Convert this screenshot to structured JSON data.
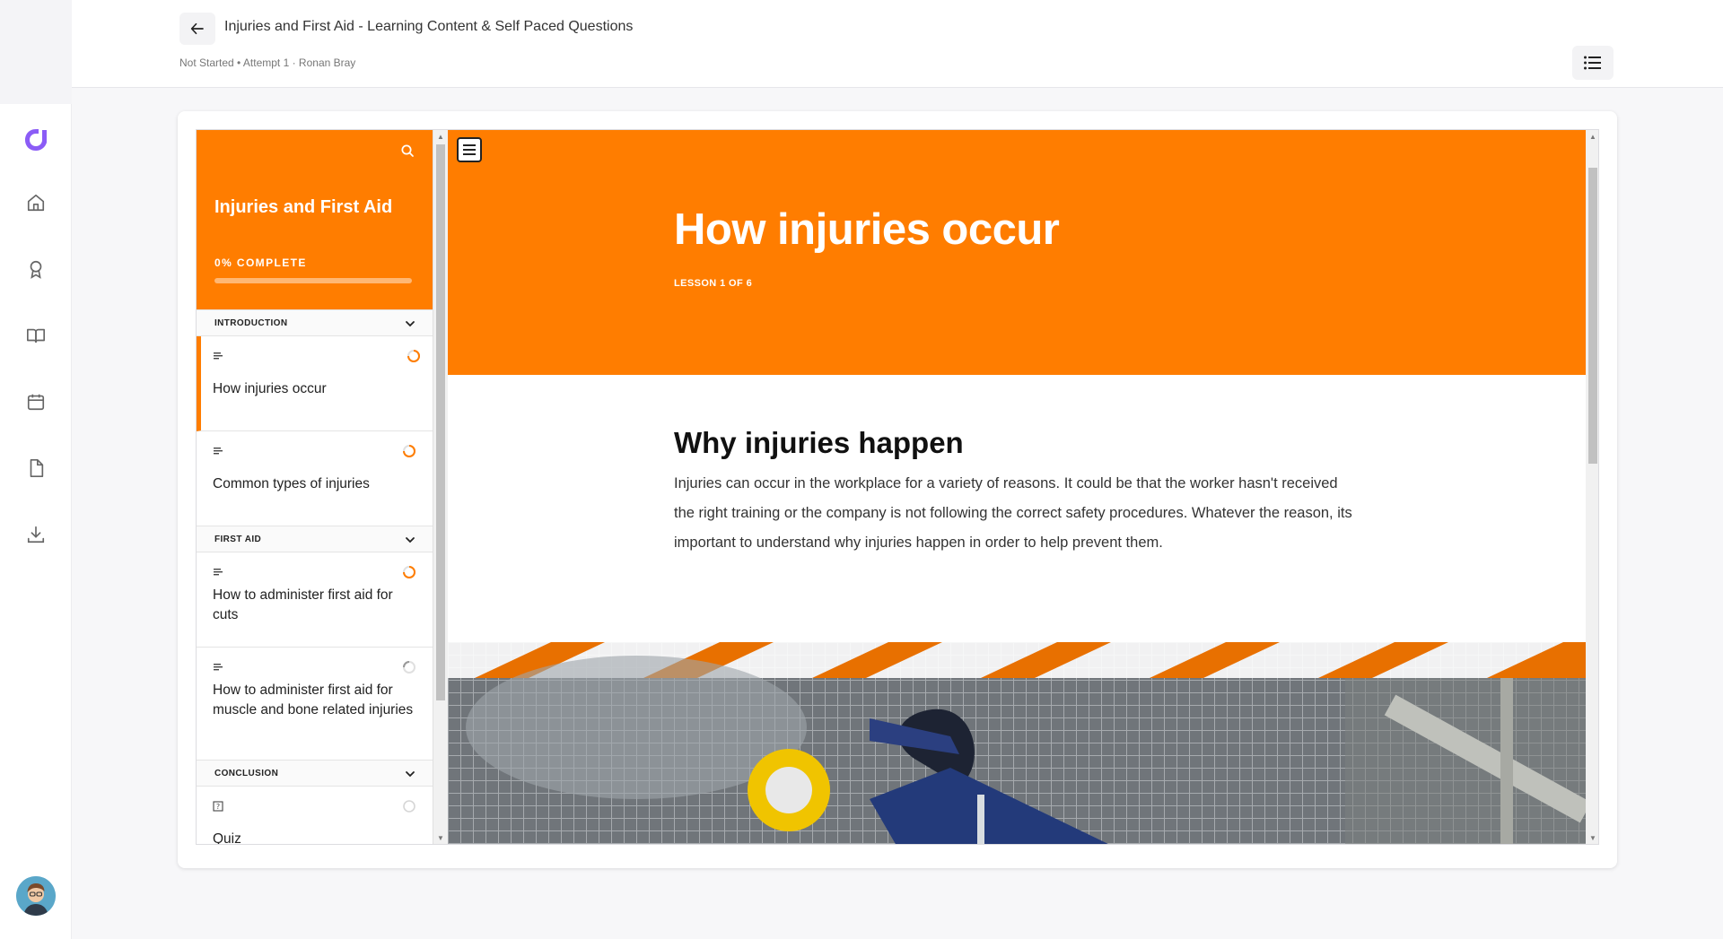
{
  "header": {
    "course_title": "Injuries and First Aid - Learning Content & Self Paced Questions",
    "meta": "Not Started • Attempt 1 · Ronan Bray"
  },
  "rail": {
    "items": [
      {
        "icon": "home-icon"
      },
      {
        "icon": "award-icon"
      },
      {
        "icon": "book-icon"
      },
      {
        "icon": "calendar-icon"
      },
      {
        "icon": "document-icon"
      },
      {
        "icon": "download-icon"
      }
    ],
    "brand_color": "#8b5cf6"
  },
  "sidebar": {
    "title": "Injuries and First Aid",
    "progress_label": "0% COMPLETE",
    "progress": 0,
    "sections": [
      {
        "label": "INTRODUCTION",
        "lessons": [
          {
            "title": "How injuries occur",
            "status": "in-progress",
            "active": true
          },
          {
            "title": "Common types of injuries",
            "status": "in-progress"
          }
        ]
      },
      {
        "label": "FIRST AID",
        "lessons": [
          {
            "title": "How to administer first aid for cuts",
            "status": "in-progress"
          },
          {
            "title": "How to administer first aid for muscle and bone related injuries",
            "status": "partial"
          }
        ]
      },
      {
        "label": "CONCLUSION",
        "lessons": [
          {
            "title": "Quiz",
            "status": "not-started"
          }
        ]
      }
    ]
  },
  "lesson": {
    "title": "How injuries occur",
    "subtitle": "LESSON 1 OF 6",
    "heading": "Why injuries happen",
    "paragraph": "Injuries can occur in the workplace for a variety of reasons. It could be that the worker hasn't received the right training or the company is not following the correct safety procedures. Whatever the reason, its important to understand why injuries happen in order to help prevent them."
  },
  "colors": {
    "accent": "#ff7d00",
    "accent_dark": "#e86a00"
  }
}
